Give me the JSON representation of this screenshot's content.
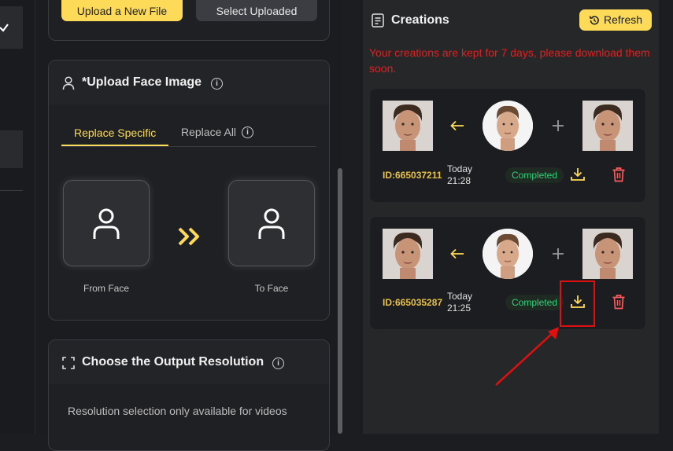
{
  "upload": {
    "upload_new_label": "Upload a New File",
    "select_uploaded_label": "Select Uploaded"
  },
  "face_section": {
    "title": "*Upload Face Image",
    "tabs": [
      {
        "label": "Replace Specific",
        "active": true
      },
      {
        "label": "Replace All",
        "active": false
      }
    ],
    "from_label": "From Face",
    "to_label": "To Face"
  },
  "resolution_section": {
    "title": "Choose the Output Resolution",
    "note": "Resolution selection only available for videos"
  },
  "creations": {
    "title": "Creations",
    "refresh_label": "Refresh",
    "notice": "Your creations are kept for 7 days, please download them soon.",
    "items": [
      {
        "id": "ID:665037211",
        "date": "Today",
        "time": "21:28",
        "status": "Completed"
      },
      {
        "id": "ID:665035287",
        "date": "Today",
        "time": "21:25",
        "status": "Completed"
      }
    ]
  },
  "colors": {
    "accent_yellow": "#fddb58",
    "notice_red": "#e02020",
    "status_green": "#2fd37a",
    "delete_red": "#ff5a5a",
    "highlight_red": "#e01010"
  }
}
